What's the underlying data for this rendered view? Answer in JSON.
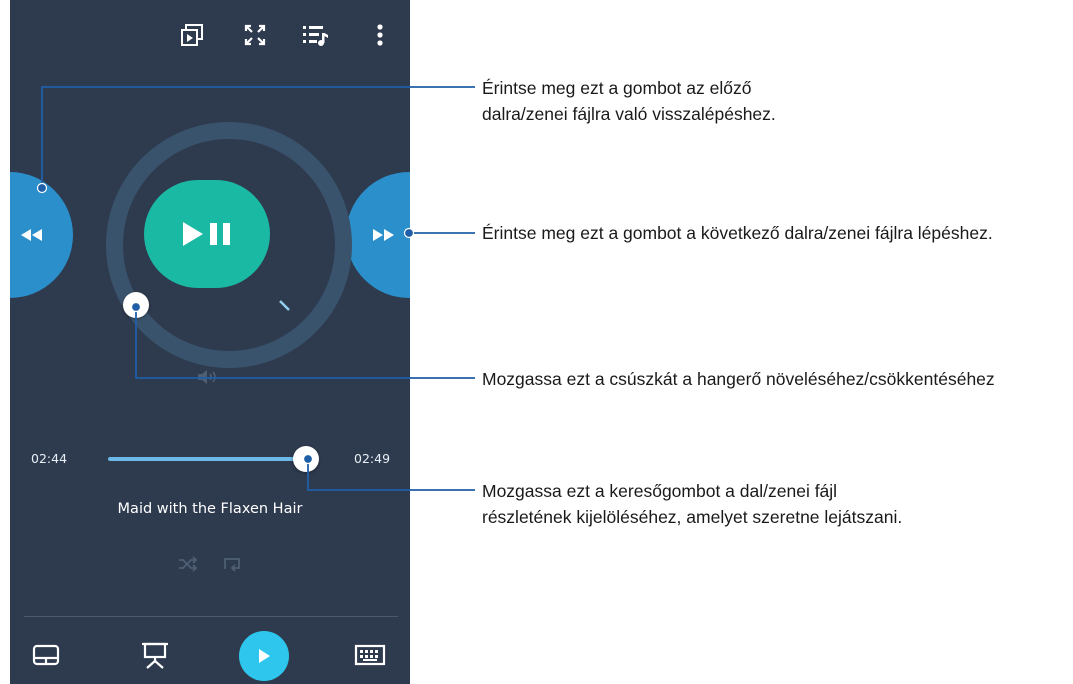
{
  "player": {
    "time_elapsed": "02:44",
    "time_total": "02:49",
    "song_title": "Maid with the Flaxen Hair",
    "seek_progress": 0.98,
    "volume_level": 0.0
  },
  "topbar": {
    "icons": [
      "picture-in-picture-play-icon",
      "fullscreen-icon",
      "playlist-music-icon",
      "more-vertical-icon"
    ]
  },
  "controls": {
    "previous_icon": "rewind-icon",
    "play_pause_icon": "play-pause-icon",
    "next_icon": "fast-forward-icon",
    "volume_icon": "volume-icon",
    "shuffle_icon": "shuffle-icon",
    "repeat_icon": "repeat-icon"
  },
  "bottombar": {
    "icons": [
      "touchpad-icon",
      "presentation-icon",
      "play-icon",
      "keyboard-icon"
    ]
  },
  "callouts": {
    "previous": "Érintse meg ezt a gombot az előző dalra/zenei fájlra való visszalépéshez.",
    "next": "Érintse meg ezt a gombot a következő dalra/zenei fájlra lépéshez.",
    "volume": "Mozgassa ezt a csúszkát a hangerő növeléséhez/csökkentéséhez",
    "seek": "Mozgassa ezt a keresőgombot a dal/zenei fájl részletének kijelöléséhez, amelyet szeretne lejátszani."
  },
  "colors": {
    "background": "#2e3a4e",
    "accent_blue": "#2b8fcb",
    "play_teal": "#1ab9a3",
    "callout_line": "#1f5fa8"
  }
}
